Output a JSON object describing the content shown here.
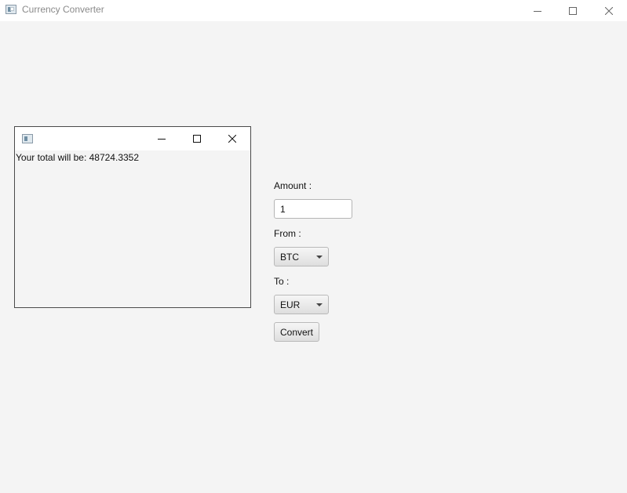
{
  "window": {
    "title": "Currency Converter",
    "controls": [
      "minimize",
      "maximize",
      "close"
    ]
  },
  "result_popup": {
    "result_text": "Your total will be: 48724.3352",
    "controls": [
      "minimize",
      "maximize",
      "close"
    ]
  },
  "form": {
    "amount_label": "Amount :",
    "amount_value": "1",
    "from_label": "From :",
    "from_value": "BTC",
    "to_label": "To :",
    "to_value": "EUR",
    "convert_label": "Convert"
  },
  "icons": {
    "app": "app-window-icon",
    "minimize": "minimize-icon",
    "maximize": "maximize-icon",
    "close": "close-icon",
    "dropdown": "chevron-down-icon"
  },
  "colors": {
    "background": "#f4f4f4",
    "titlebar": "#ffffff",
    "title_text": "#8a8a8a",
    "popup_border": "#4a4a4a"
  }
}
